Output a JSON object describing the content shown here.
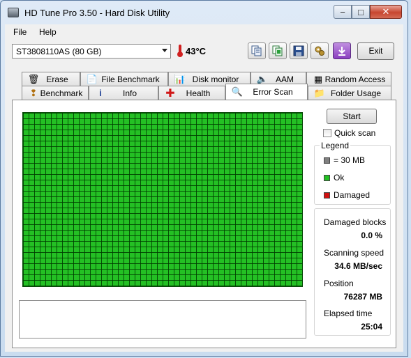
{
  "window": {
    "title": "HD Tune Pro 3.50 - Hard Disk Utility",
    "minimize": "−",
    "maximize": "□",
    "close": "✕"
  },
  "menu": {
    "file": "File",
    "help": "Help"
  },
  "toolbar": {
    "drive": "ST3808110AS (80 GB)",
    "temperature": "43°C",
    "exit_label": "Exit",
    "icons": [
      "copy-text-icon",
      "copy-screenshot-icon",
      "save-icon",
      "options-icon",
      "download-icon"
    ]
  },
  "tabs": {
    "back": [
      "Erase",
      "File Benchmark",
      "Disk monitor",
      "AAM",
      "Random Access"
    ],
    "front": [
      "Benchmark",
      "Info",
      "Health",
      "Error Scan",
      "Folder Usage"
    ],
    "active": "Error Scan"
  },
  "scan": {
    "start_label": "Start",
    "quick_scan_label": "Quick scan",
    "quick_scan_checked": false,
    "grid_status": "ok"
  },
  "legend": {
    "title": "Legend",
    "items": [
      {
        "label": "= 30 MB",
        "color": "#808080"
      },
      {
        "label": "Ok",
        "color": "#22c022"
      },
      {
        "label": "Damaged",
        "color": "#d01010"
      }
    ]
  },
  "stats": {
    "damaged_blocks_label": "Damaged blocks",
    "damaged_blocks_value": "0.0 %",
    "scanning_speed_label": "Scanning speed",
    "scanning_speed_value": "34.6 MB/sec",
    "position_label": "Position",
    "position_value": "76287 MB",
    "elapsed_label": "Elapsed time",
    "elapsed_value": "25:04"
  }
}
